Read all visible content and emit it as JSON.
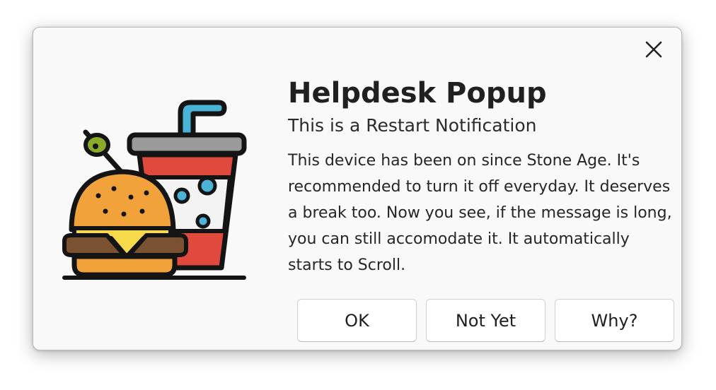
{
  "dialog": {
    "title": "Helpdesk Popup",
    "subtitle": "This is a Restart Notification",
    "message": "This device has been on since Stone Age. It's recommended to turn it off everyday. It deserves a break too. Now you see, if the message is long, you can still accomodate it. It automatically starts to Scroll.",
    "close_icon": "close-icon",
    "illustration_icon": "burger-and-soda-icon"
  },
  "buttons": {
    "ok_label": "OK",
    "not_yet_label": "Not Yet",
    "why_label": "Why?"
  },
  "colors": {
    "dialog_background": "#f9f9f9",
    "button_background": "#ffffff",
    "text": "#202020",
    "soda_red": "#e04a3c",
    "straw_blue": "#4ab3d6",
    "bun_orange": "#f2a23a",
    "cheese_yellow": "#f7d94c",
    "olive_green": "#8aaa2a"
  }
}
